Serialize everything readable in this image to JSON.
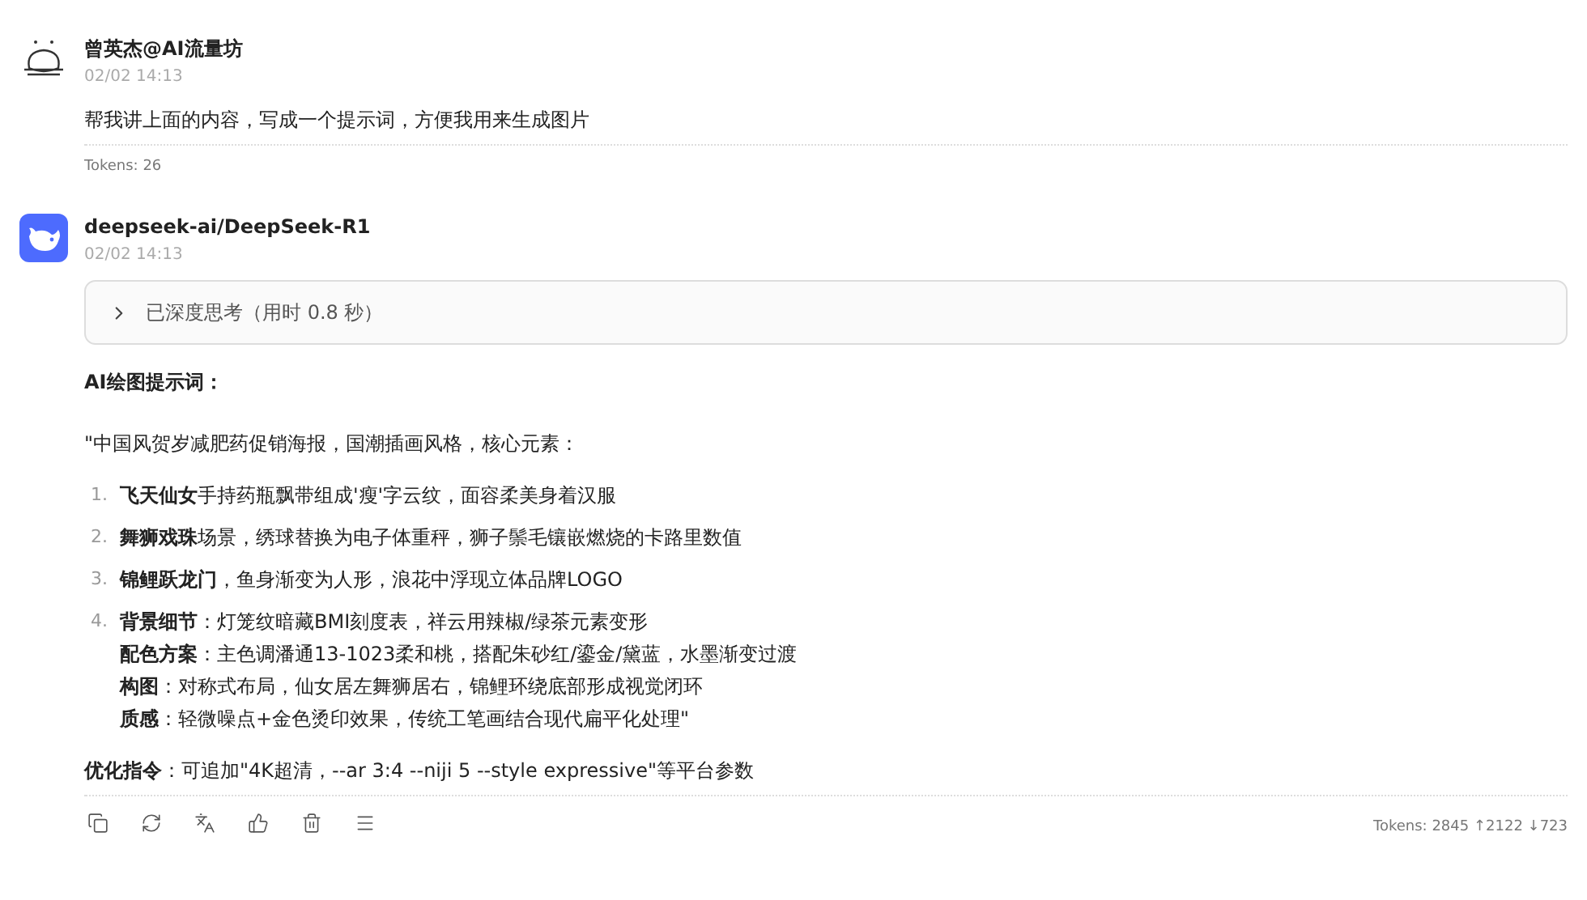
{
  "messages": [
    {
      "kind": "user",
      "author": "曾英杰@AI流量坊",
      "time": "02/02 14:13",
      "text": "帮我讲上面的内容，写成一个提示词，方便我用来生成图片",
      "tokens": "Tokens: 26"
    },
    {
      "kind": "assistant",
      "author": "deepseek-ai/DeepSeek-R1",
      "time": "02/02 14:13",
      "thinking": {
        "label": "已深度思考（用时 0.8 秒）",
        "expanded": false
      },
      "heading": "AI绘图提示词：",
      "intro": "\"中国风贺岁减肥药促销海报，国潮插画风格，核心元素：",
      "items": [
        {
          "number": "1.",
          "lines": [
            "**飞天仙女**手持药瓶飘带组成'瘦'字云纹，面容柔美身着汉服"
          ]
        },
        {
          "number": "2.",
          "lines": [
            "**舞狮戏珠**场景，绣球替换为电子体重秤，狮子鬃毛镶嵌燃烧的卡路里数值"
          ]
        },
        {
          "number": "3.",
          "lines": [
            "**锦鲤跃龙门**，鱼身渐变为人形，浪花中浮现立体品牌LOGO"
          ]
        },
        {
          "number": "4.",
          "lines": [
            "**背景细节**：灯笼纹暗藏BMI刻度表，祥云用辣椒/绿茶元素变形",
            "**配色方案**：主色调潘通13-1023柔和桃，搭配朱砂红/鎏金/黛蓝，水墨渐变过渡",
            "**构图**：对称式布局，仙女居左舞狮居右，锦鲤环绕底部形成视觉闭环",
            "**质感**：轻微噪点+金色烫印效果，传统工笔画结合现代扁平化处理\""
          ]
        }
      ],
      "note": "**优化指令**：可追加\"4K超清，--ar 3:4 --niji 5 --style expressive\"等平台参数",
      "actions": [
        {
          "kind": "copy"
        },
        {
          "kind": "regenerate"
        },
        {
          "kind": "translate"
        },
        {
          "kind": "like"
        },
        {
          "kind": "delete"
        },
        {
          "kind": "menu"
        }
      ],
      "tokens": "Tokens: 2845 ↑2122 ↓723"
    }
  ]
}
